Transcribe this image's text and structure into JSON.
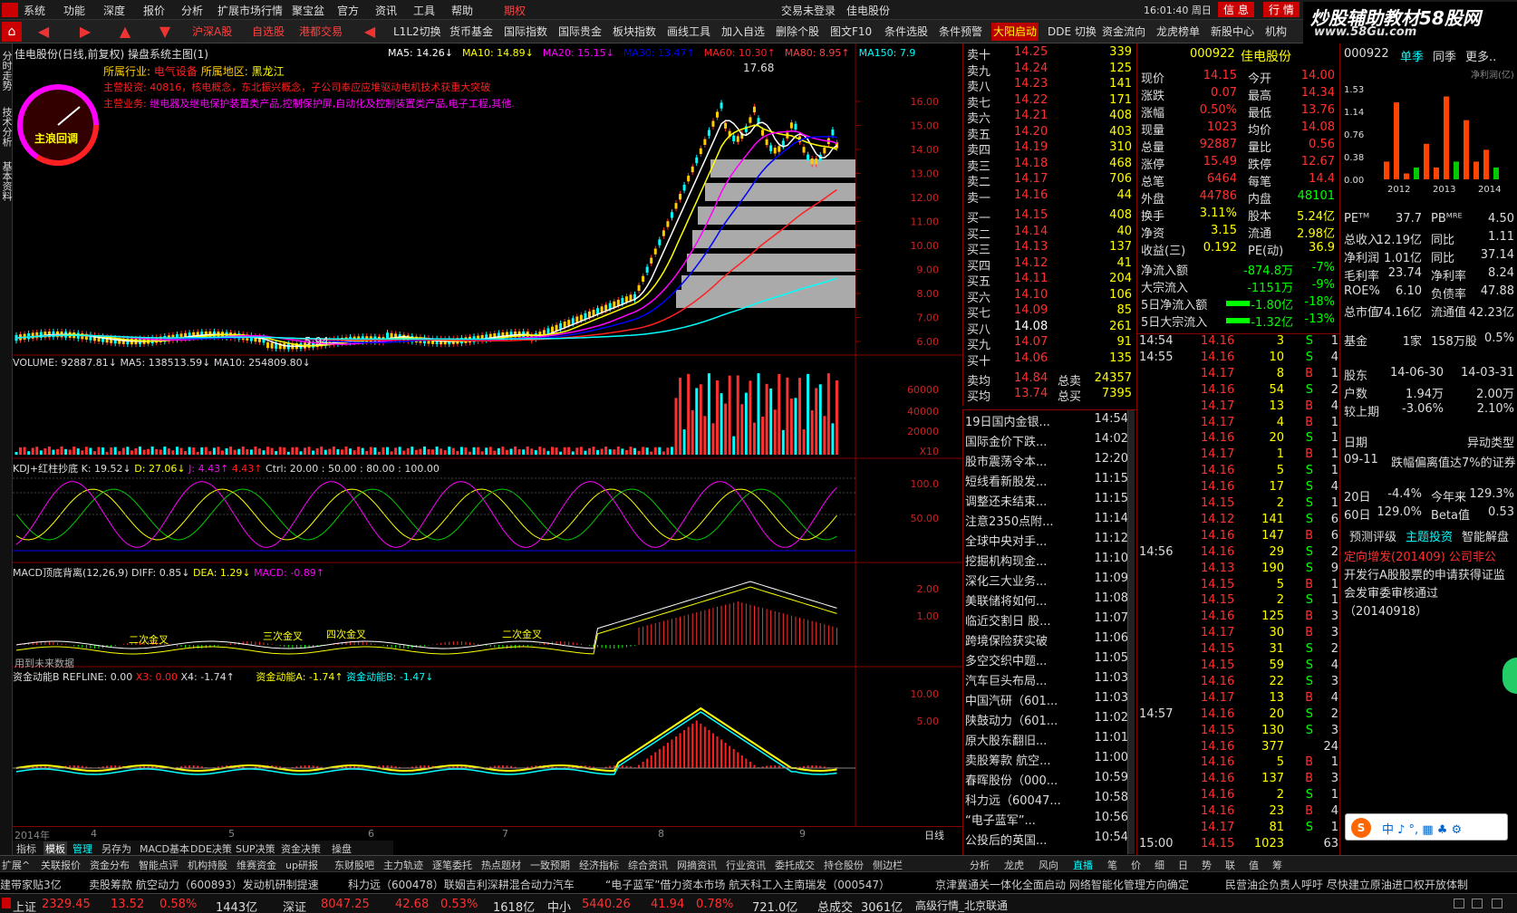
{
  "menu": [
    "系统",
    "功能",
    "深度",
    "报价",
    "分析",
    "扩展市场行情",
    "聚宝盆",
    "官方",
    "资讯",
    "工具",
    "帮助",
    "期权"
  ],
  "center_title": [
    "交易未登录",
    "佳电股份"
  ],
  "clock": "16:01:40 周日",
  "right_buttons": [
    "信 息",
    "行 情"
  ],
  "brand": "炒股辅助教材58股网",
  "brand_url": "www.58Gu.com",
  "toolbar": [
    "沪深A股",
    "自选股",
    "港都交易",
    "L1L2切换",
    "货币基金",
    "国际指数",
    "国际贵金",
    "板块指数",
    "画线工具",
    "加入自选",
    "删除个股",
    "图文F10",
    "条件选股",
    "条件预警",
    "大阳启动",
    "DDE 切换",
    "资金流向",
    "龙虎榜单",
    "新股中心",
    "机构"
  ],
  "left_tabs": [
    "分时走势",
    "技术分析",
    "基本资料"
  ],
  "chart_header": {
    "title": "佳电股份(日线,前复权) 操盘系统主图(1)",
    "ma": [
      {
        "t": "MA5: 14.26↓",
        "c": "#ffffff"
      },
      {
        "t": "MA10: 14.89↓",
        "c": "#ffff00"
      },
      {
        "t": "MA20: 15.15↓",
        "c": "#ff00ff"
      },
      {
        "t": "MA30: 13.47↑",
        "c": "#0000ff"
      },
      {
        "t": "MA60: 10.30↑",
        "c": "#ff2020"
      },
      {
        "t": "MA80: 8.95↑",
        "c": "#ff4040"
      },
      {
        "t": "MA150: 7.9",
        "c": "#00ffff"
      }
    ],
    "info": [
      {
        "k": "所属行业:",
        "v": "电气设备",
        "k2": "所属地区:",
        "v2": "黑龙江"
      },
      {
        "k": "主营投资:",
        "v": "40816，核电概念，东北振兴概念，子公司奉应应堆驱动电机技术获重大突破"
      },
      {
        "k": "主营业务:",
        "v": "继电器及继电保护装置类产品,控制保护屏,自动化及控制装置类产品,电子工程,其他."
      }
    ],
    "peak": "17.68",
    "low": "5.94",
    "badge": "主浪回调"
  },
  "price_axis": [
    "16.00",
    "15.00",
    "14.00",
    "13.00",
    "12.00",
    "11.00",
    "10.00",
    "9.00",
    "8.00",
    "7.00",
    "6.00"
  ],
  "vol_header": "VOLUME: 92887.81↓  MA5: 138513.59↓  MA10: 254809.80↓",
  "vol_axis": [
    "60000",
    "40000",
    "20000",
    "X10"
  ],
  "kdj_header": {
    "a": "KDJ+红柱抄底 K: 19.52↓",
    "b": "D: 27.06↓",
    "c": "J: 4.43↑",
    "d": "4.43↑",
    "e": "Ctrl: 20.00 : 50.00 : 80.00 : 100.00"
  },
  "kdj_axis": [
    "100.0",
    "50.00"
  ],
  "macd_header": {
    "a": "MACD顶底背离(12,26,9) DIFF: 0.85↓",
    "b": "DEA: 1.29↓",
    "c": "MACD: -0.89↑"
  },
  "macd_axis": [
    "2.00",
    "1.00"
  ],
  "macd_labels": [
    "二次金叉",
    "三次金叉",
    "四次金叉",
    "二次金叉",
    "用到未来数据"
  ],
  "fund_header": {
    "a": "资金动能B REFLINE: 0.00",
    "b": "X3: 0.00",
    "c": "X4: -1.74↑",
    "d": "资金动能A: -1.74↑",
    "e": "资金动能B: -1.47↓"
  },
  "fund_axis": [
    "10.00",
    "5.00"
  ],
  "x_axis": [
    "2014年",
    "4",
    "5",
    "6",
    "7",
    "8",
    "9"
  ],
  "x_label": "日线",
  "chart_tabs": [
    "指标",
    "模板",
    "管理",
    "另存为",
    "MACD基本",
    "DDE决策",
    "SUP决策",
    "资金决策",
    "操盘"
  ],
  "order_book": {
    "sell": [
      [
        "卖十",
        "14.25",
        "339"
      ],
      [
        "卖九",
        "14.24",
        "125"
      ],
      [
        "卖八",
        "14.23",
        "141"
      ],
      [
        "卖七",
        "14.22",
        "171"
      ],
      [
        "卖六",
        "14.21",
        "408"
      ],
      [
        "卖五",
        "14.20",
        "403"
      ],
      [
        "卖四",
        "14.19",
        "310"
      ],
      [
        "卖三",
        "14.18",
        "468"
      ],
      [
        "卖二",
        "14.17",
        "706"
      ],
      [
        "卖一",
        "14.16",
        "44"
      ]
    ],
    "buy": [
      [
        "买一",
        "14.15",
        "408"
      ],
      [
        "买二",
        "14.14",
        "40"
      ],
      [
        "买三",
        "14.13",
        "137"
      ],
      [
        "买四",
        "14.12",
        "41"
      ],
      [
        "买五",
        "14.11",
        "204"
      ],
      [
        "买六",
        "14.10",
        "106"
      ],
      [
        "买七",
        "14.09",
        "85"
      ],
      [
        "买八",
        "14.08",
        "261"
      ],
      [
        "买九",
        "14.07",
        "91"
      ],
      [
        "买十",
        "14.06",
        "135"
      ]
    ],
    "avg": [
      [
        "卖均",
        "14.84",
        "总卖",
        "24357"
      ],
      [
        "买均",
        "13.74",
        "总买",
        "7395"
      ]
    ]
  },
  "quote": {
    "code": "000922",
    "name": "佳电股份",
    "rows": [
      [
        "现价",
        "14.15",
        "今开",
        "14.00"
      ],
      [
        "涨跌",
        "0.07",
        "最高",
        "14.34"
      ],
      [
        "涨幅",
        "0.50%",
        "最低",
        "13.76"
      ],
      [
        "现量",
        "1023",
        "均价",
        "14.08"
      ],
      [
        "总量",
        "92887",
        "量比",
        "0.56"
      ],
      [
        "涨停",
        "15.49",
        "跌停",
        "12.67"
      ],
      [
        "总笔",
        "6464",
        "每笔",
        "14.4"
      ],
      [
        "外盘",
        "44786",
        "内盘",
        "48101"
      ],
      [
        "换手",
        "3.11%",
        "股本",
        "5.24亿"
      ],
      [
        "净资",
        "3.15",
        "流通",
        "2.98亿"
      ],
      [
        "收益(三)",
        "0.192",
        "PE(动)",
        "36.9"
      ]
    ],
    "flows": [
      [
        "净流入额",
        "-874.8万",
        "-7%"
      ],
      [
        "大宗流入",
        "-1151万",
        "-9%"
      ],
      [
        "5日净流入额",
        "-1.80亿",
        "-18%"
      ],
      [
        "5日大宗流入",
        "-1.32亿",
        "-13%"
      ]
    ]
  },
  "news": [
    [
      "19日国内金银...",
      "14:54"
    ],
    [
      "国际金价下跌...",
      "14:02"
    ],
    [
      "股市震荡令本...",
      "12:20"
    ],
    [
      "短线看新股发...",
      "11:15"
    ],
    [
      "调整还未结束...",
      "11:15"
    ],
    [
      "注意2350点附...",
      "11:14"
    ],
    [
      "全球中央对手...",
      "11:12"
    ],
    [
      "挖掘机构现金...",
      "11:10"
    ],
    [
      "深化三大业务...",
      "11:09"
    ],
    [
      "美联储将如何...",
      "11:08"
    ],
    [
      "临近交割日 股...",
      "11:07"
    ],
    [
      "跨境保险获实破",
      "11:06"
    ],
    [
      "多空交织中题...",
      "11:05"
    ],
    [
      "汽车巨头布局...",
      "11:03"
    ],
    [
      "中国汽研（601...",
      "11:03"
    ],
    [
      "陕鼓动力（601...",
      "11:02"
    ],
    [
      "原大股东翻旧...",
      "11:01"
    ],
    [
      "卖股筹款 航空...",
      "11:00"
    ],
    [
      "春晖股份（000...",
      "10:59"
    ],
    [
      "科力远（60047...",
      "10:58"
    ],
    [
      "“电子蓝军”...",
      "10:56"
    ],
    [
      "公投后的英国...",
      "10:54"
    ]
  ],
  "ticks": [
    [
      "14:54",
      "14.16",
      "3",
      "S",
      "1"
    ],
    [
      "14:55",
      "14.16",
      "10",
      "S",
      "4"
    ],
    [
      "",
      "14.17",
      "8",
      "B",
      "1"
    ],
    [
      "",
      "14.16",
      "54",
      "S",
      "2"
    ],
    [
      "",
      "14.17",
      "13",
      "B",
      "4"
    ],
    [
      "",
      "14.17",
      "4",
      "B",
      "1"
    ],
    [
      "",
      "14.16",
      "20",
      "S",
      "1"
    ],
    [
      "",
      "14.17",
      "1",
      "B",
      "1"
    ],
    [
      "",
      "14.16",
      "5",
      "S",
      "1"
    ],
    [
      "",
      "14.16",
      "17",
      "S",
      "4"
    ],
    [
      "",
      "14.15",
      "2",
      "S",
      "1"
    ],
    [
      "",
      "14.12",
      "141",
      "S",
      "6"
    ],
    [
      "",
      "14.16",
      "147",
      "B",
      "6"
    ],
    [
      "14:56",
      "14.16",
      "29",
      "S",
      "2"
    ],
    [
      "",
      "14.13",
      "190",
      "S",
      "9"
    ],
    [
      "",
      "14.15",
      "5",
      "B",
      "1"
    ],
    [
      "",
      "14.15",
      "2",
      "S",
      "1"
    ],
    [
      "",
      "14.16",
      "125",
      "B",
      "3"
    ],
    [
      "",
      "14.17",
      "30",
      "B",
      "3"
    ],
    [
      "",
      "14.15",
      "31",
      "S",
      "2"
    ],
    [
      "",
      "14.15",
      "59",
      "S",
      "4"
    ],
    [
      "",
      "14.16",
      "22",
      "S",
      "3"
    ],
    [
      "",
      "14.17",
      "13",
      "B",
      "4"
    ],
    [
      "14:57",
      "14.16",
      "20",
      "S",
      "2"
    ],
    [
      "",
      "14.15",
      "130",
      "S",
      "3"
    ],
    [
      "",
      "14.16",
      "377",
      "",
      "24"
    ],
    [
      "",
      "14.16",
      "5",
      "B",
      "1"
    ],
    [
      "",
      "14.16",
      "137",
      "B",
      "3"
    ],
    [
      "",
      "14.16",
      "2",
      "S",
      "1"
    ],
    [
      "",
      "14.16",
      "23",
      "B",
      "4"
    ],
    [
      "",
      "14.17",
      "81",
      "S",
      "1"
    ],
    [
      "15:00",
      "14.15",
      "1023",
      "",
      "63"
    ]
  ],
  "f10": {
    "code": "000922",
    "tabs": [
      "单季",
      "同季",
      "更多.."
    ],
    "chart_label": "净利润(亿)",
    "chart_axis": [
      "1.53",
      "1.14",
      "0.76",
      "0.38",
      "0.00"
    ],
    "years": [
      "2012",
      "2013",
      "2014"
    ],
    "rows": [
      [
        "PEᵀᴹ",
        "37.7",
        "PBᴹᴿᴱ",
        "4.50"
      ],
      [
        "总收入",
        "12.19亿",
        "同比",
        "1.11"
      ],
      [
        "净利润",
        "1.01亿",
        "同比",
        "37.14"
      ],
      [
        "毛利率",
        "23.74",
        "净利率",
        "8.24"
      ],
      [
        "ROE%",
        "6.10",
        "负债率",
        "47.88"
      ],
      [
        "总市值",
        "74.16亿",
        "流通值",
        "42.23亿"
      ]
    ],
    "fund": [
      "基金",
      "1家",
      "158万股",
      "0.5%"
    ],
    "holders": [
      [
        "股东",
        "14-06-30",
        "14-03-31"
      ],
      [
        "户数",
        "1.94万",
        "2.00万"
      ],
      [
        "较上期",
        "-3.06%",
        "2.10%"
      ]
    ],
    "dates_header": [
      "日期",
      "异动类型"
    ],
    "event": [
      "09-11",
      "跌幅偏离值达7%的证券"
    ],
    "perf": [
      [
        "20日",
        "-4.4%",
        "今年来",
        "129.3%"
      ],
      [
        "60日",
        "129.0%",
        "Beta值",
        "0.53"
      ]
    ],
    "tabs2": [
      "预测评级",
      "主题投资",
      "智能解盘"
    ],
    "note": [
      "定向增发(201409) 公司非公",
      "开发行A股股票的申请获得证监",
      "会发审委审核通过",
      "（20140918）"
    ]
  },
  "bottom_tabs": [
    "扩展^",
    "关联报价",
    "资金分布",
    "智能点评",
    "机构持股",
    "维赛资金",
    "up研报",
    "东财股吧",
    "主力轨迹",
    "逐笔委托",
    "热点题材",
    "一致预期",
    "经济指标",
    "综合资讯",
    "网摘资讯",
    "行业资讯",
    "委托成交",
    "持仓股份",
    "侧边栏"
  ],
  "bottom_tabs2": [
    "分析",
    "龙虎",
    "风向",
    "直播",
    "笔",
    "价",
    "细",
    "日",
    "势",
    "联",
    "值",
    "筹"
  ],
  "marquee": [
    "建带家贴3亿",
    "卖股筹款 航空动力（600893）发动机研制提速",
    "科力远（600478）联姻吉利深耕混合动力汽车",
    "“电子蓝军”借力资本市场 航天科工入主南瑞发（000547）",
    "京津冀通关一体化全面启动 网络智能化管理方向确定",
    "民营油企负责人呼吁 尽快建立原油进口权开放体制"
  ],
  "status": [
    {
      "l": "上证",
      "v": "2329.45",
      "d": "13.52",
      "p": "0.58%",
      "a": "1443亿"
    },
    {
      "l": "深证",
      "v": "8047.25",
      "d": "42.68",
      "p": "0.53%",
      "a": "1618亿"
    },
    {
      "l": "中小",
      "v": "5440.26",
      "d": "41.94",
      "p": "0.78%",
      "a": "721.0亿"
    }
  ],
  "status_extra": [
    "总成交",
    "3061亿",
    "高级行情_北京联通"
  ],
  "colors": {
    "up": "#ff3030",
    "down": "#00ff00",
    "yellow": "#ffff00",
    "cyan": "#00ffff",
    "magenta": "#ff00ff"
  }
}
